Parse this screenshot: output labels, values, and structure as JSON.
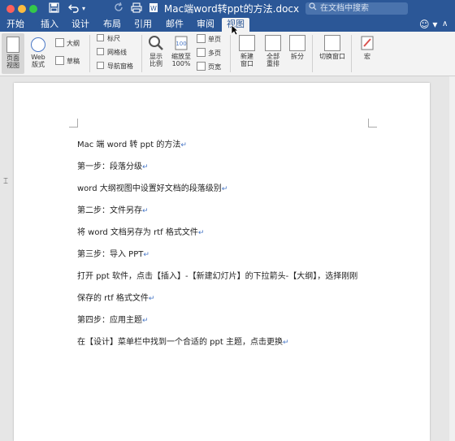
{
  "titlebar": {
    "document_title": "Mac端word转ppt的方法.docx",
    "search_placeholder": "在文档中搜索",
    "quick_access": [
      "save-icon",
      "undo-icon",
      "redo-icon",
      "print-icon"
    ]
  },
  "tabs": [
    {
      "label": "开始"
    },
    {
      "label": "插入"
    },
    {
      "label": "设计"
    },
    {
      "label": "布局"
    },
    {
      "label": "引用"
    },
    {
      "label": "邮件"
    },
    {
      "label": "审阅"
    },
    {
      "label": "视图",
      "active": true
    }
  ],
  "ribbon": {
    "page_view": "页面视图",
    "web_view": "Web 版式",
    "outline": "大纲",
    "draft": "草稿",
    "ruler": "标尺",
    "gridlines": "网格线",
    "nav_pane": "导航窗格",
    "show_ratio": "显示比例",
    "zoom_100": "缩放至 100%",
    "single_page": "单页",
    "multi_page": "多页",
    "page_width": "页宽",
    "new_window": "新建窗口",
    "arrange_all": "全部重排",
    "split": "拆分",
    "switch_windows": "切换窗口",
    "macros": "宏"
  },
  "document": {
    "lines": [
      "Mac 端 word 转 ppt 的方法",
      "第一步：段落分级",
      "word  大纲视图中设置好文档的段落级别",
      "第二步：文件另存",
      "将 word 文档另存为 rtf 格式文件",
      "第三步：导入 PPT",
      "打开 ppt 软件，点击【插入】-【新建幻灯片】的下拉箭头-【大纲】，选择刚刚",
      "保存的 rtf 格式文件",
      "第四步：应用主题",
      "在【设计】菜单栏中找到一个合适的 ppt 主题，点击更换"
    ],
    "paragraph_mark": "↵"
  },
  "colors": {
    "title_bar": "#2b5797",
    "ribbon_bg": "#f3f3f3",
    "workspace": "#e6e6e6"
  }
}
